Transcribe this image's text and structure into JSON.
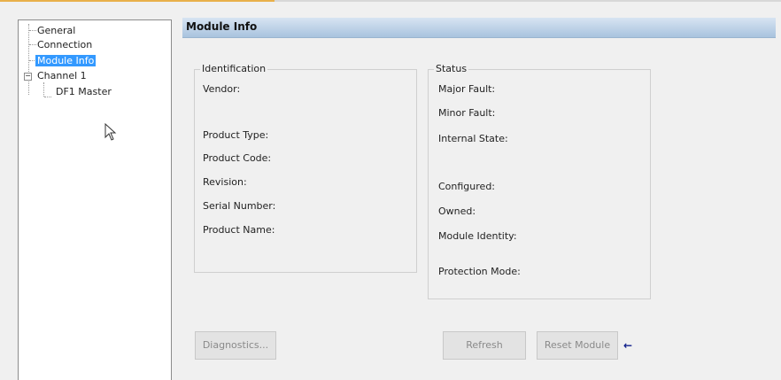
{
  "tree": {
    "items": [
      {
        "label": "General"
      },
      {
        "label": "Connection"
      },
      {
        "label": "Module Info"
      },
      {
        "label": "Channel 1"
      },
      {
        "label": "DF1 Master"
      }
    ],
    "expander_symbol": "−"
  },
  "header": {
    "title": "Module Info"
  },
  "identification": {
    "title": "Identification",
    "fields": [
      "Vendor:",
      "Product Type:",
      "Product Code:",
      "Revision:",
      "Serial Number:",
      "Product Name:"
    ]
  },
  "status": {
    "title": "Status",
    "fields": [
      "Major Fault:",
      "Minor Fault:",
      "Internal State:",
      "Configured:",
      "Owned:",
      "Module Identity:",
      "Protection Mode:"
    ]
  },
  "buttons": {
    "diagnostics": "Diagnostics...",
    "refresh": "Refresh",
    "reset_module": "Reset Module"
  },
  "arrow_glyph": "←",
  "icons": {
    "cursor": "mouse-pointer-icon",
    "arrow": "left-arrow-icon"
  }
}
